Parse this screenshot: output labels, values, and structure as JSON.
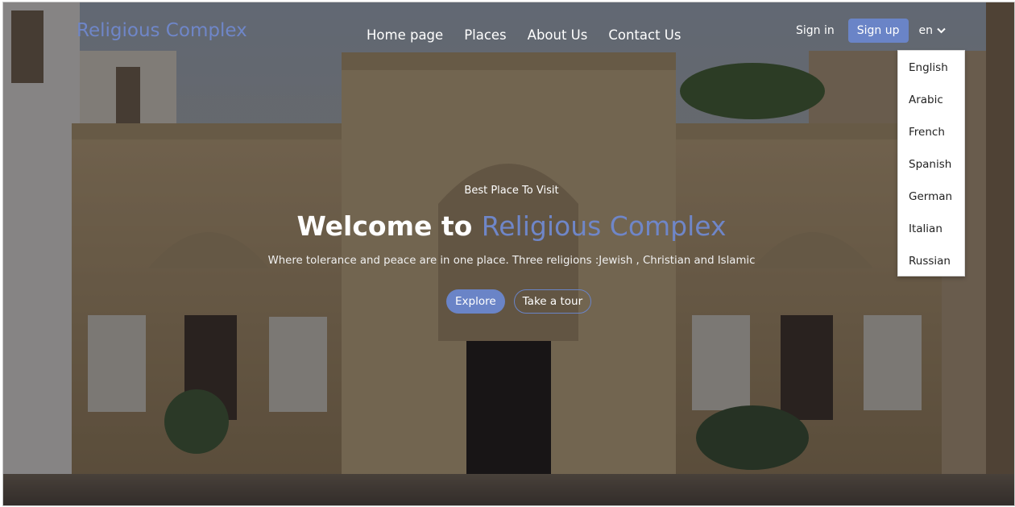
{
  "brand": "Religious Complex",
  "nav": {
    "home": "Home page",
    "places": "Places",
    "about": "About Us",
    "contact": "Contact Us"
  },
  "auth": {
    "signin": "Sign in",
    "signup": "Sign up",
    "lang": "en"
  },
  "languages": [
    "English",
    "Arabic",
    "French",
    "Spanish",
    "German",
    "Italian",
    "Russian"
  ],
  "hero": {
    "kicker": "Best Place To Visit",
    "title_prefix": "Welcome to",
    "title_accent": "Religious Complex",
    "subtitle": "Where tolerance and peace are in one place. Three religions :Jewish , Christian and Islamic",
    "explore": "Explore",
    "tour": "Take a tour"
  },
  "colors": {
    "accent": "#6a84c7",
    "brand": "#6f86c8"
  },
  "icons": {
    "lang_toggle": "chevron-down-icon"
  }
}
